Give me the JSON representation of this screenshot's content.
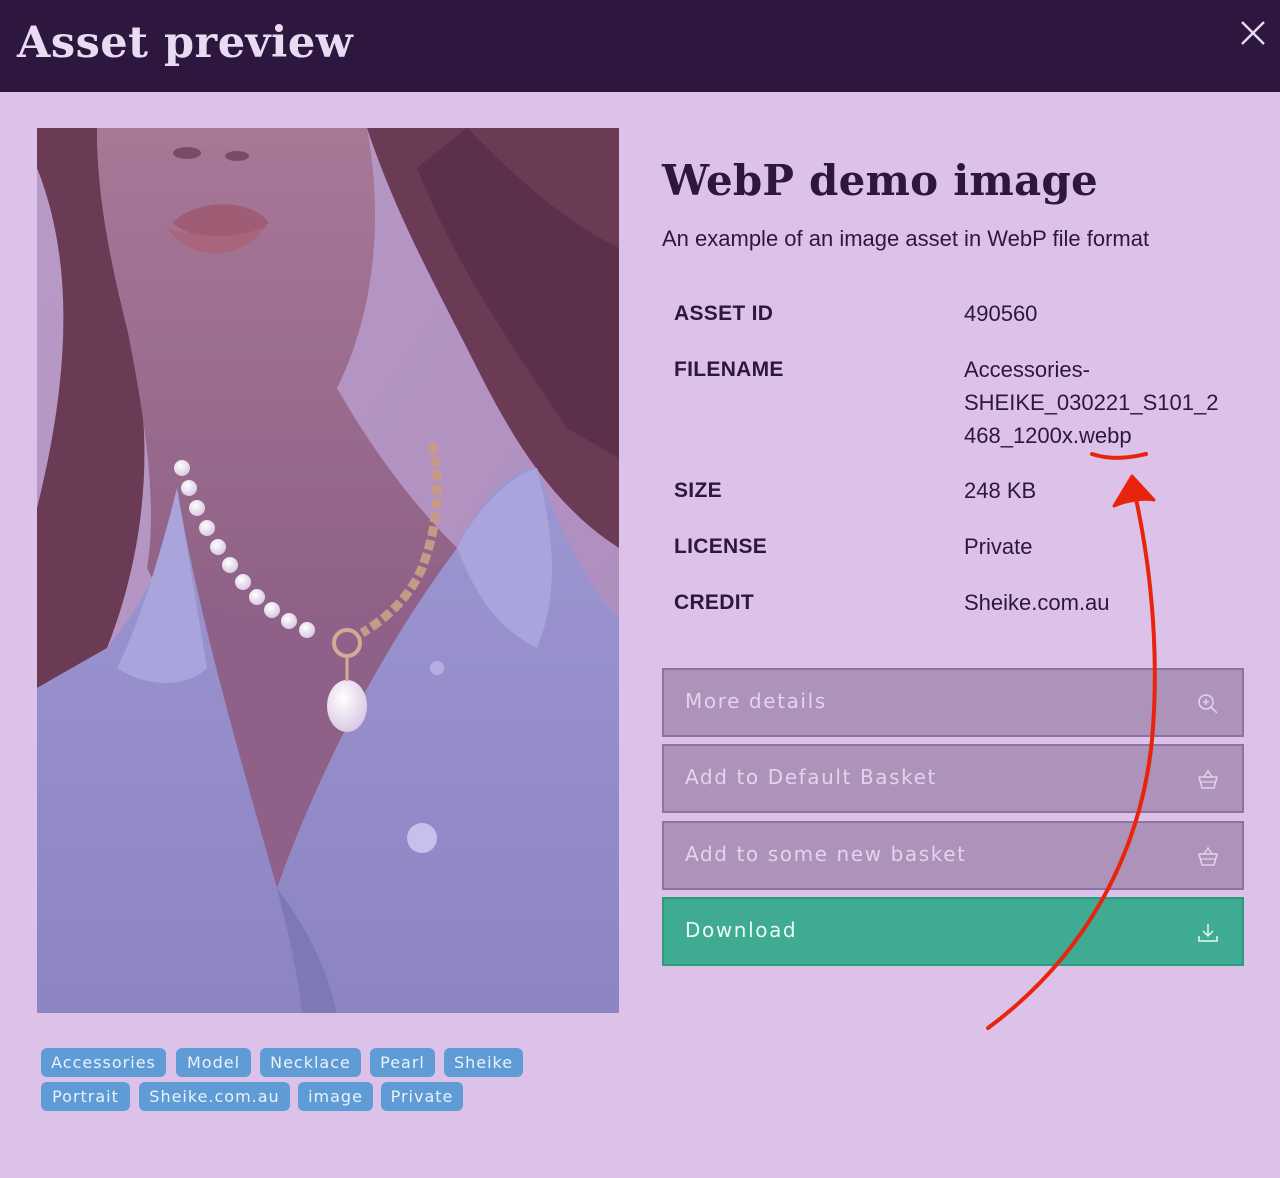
{
  "header": {
    "title": "Asset preview",
    "close_icon": "close-icon"
  },
  "asset": {
    "title": "WebP demo image",
    "description": "An example of an image asset in WebP file format"
  },
  "metadata": {
    "asset_id": {
      "label": "ASSET ID",
      "value": "490560"
    },
    "filename": {
      "label": "FILENAME",
      "lines": [
        "Accessories-",
        "SHEIKE_030221_S101_2",
        "468_1200x.webp"
      ]
    },
    "size": {
      "label": "SIZE",
      "value": "248 KB"
    },
    "license": {
      "label": "LICENSE",
      "value": "Private"
    },
    "credit": {
      "label": "CREDIT",
      "value": "Sheike.com.au"
    }
  },
  "actions": {
    "more_details": {
      "label": "More details",
      "icon": "zoom-in-icon"
    },
    "add_default_basket": {
      "label": "Add to Default Basket",
      "icon": "basket-icon"
    },
    "add_new_basket": {
      "label": "Add to some new basket",
      "icon": "basket-icon"
    },
    "download": {
      "label": "Download",
      "icon": "download-icon"
    }
  },
  "tags": [
    "Accessories",
    "Model",
    "Necklace",
    "Pearl",
    "Sheike",
    "Portrait",
    "Sheike.com.au",
    "image",
    "Private"
  ],
  "colors": {
    "header_bg": "#2e173f",
    "page_bg": "#dcc2e9",
    "button_bg": "#ad93b9",
    "download_bg": "#3fab93",
    "tag_bg": "#5f9bd5",
    "annotation": "#e8240c"
  }
}
